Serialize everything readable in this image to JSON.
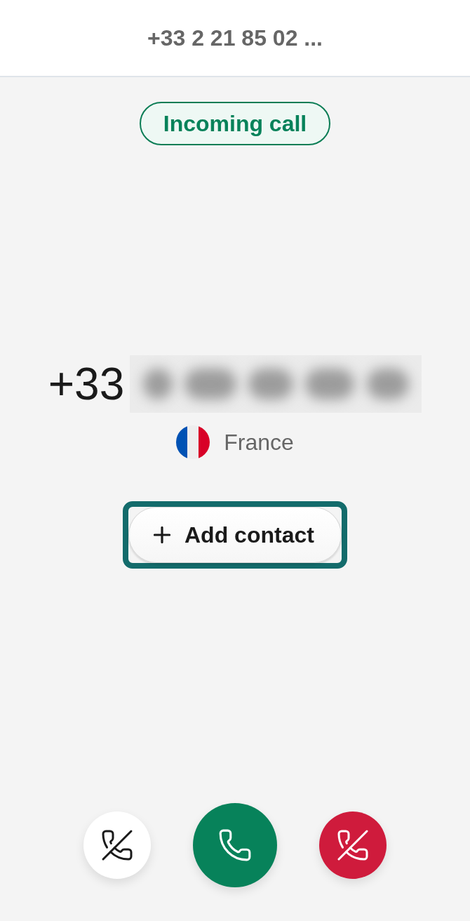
{
  "header": {
    "title": "+33 2 21 85 02 ..."
  },
  "status_badge": {
    "label": "Incoming call"
  },
  "caller": {
    "number": "+33",
    "redacted": true,
    "country": "France"
  },
  "add_contact": {
    "label": "Add contact",
    "focused": true
  },
  "actions": [
    {
      "kind": "ignore"
    },
    {
      "kind": "answer"
    },
    {
      "kind": "decline"
    }
  ]
}
